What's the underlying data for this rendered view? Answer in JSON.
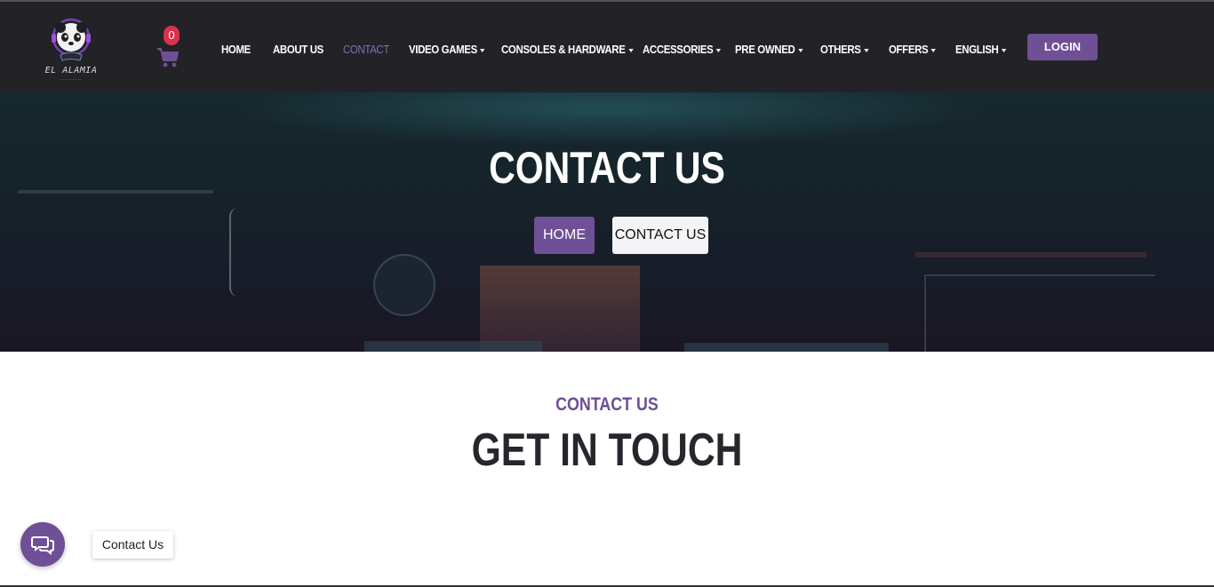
{
  "brand": {
    "name": "EL ALAMIA",
    "logo_icon": "panda-gamer-logo",
    "accent_color": "#6f4f96"
  },
  "cart": {
    "count": "0",
    "icon": "cart-icon"
  },
  "nav": {
    "items": [
      {
        "label": "HOME",
        "dropdown": false
      },
      {
        "label": "ABOUT US",
        "dropdown": false
      },
      {
        "label": "CONTACT",
        "dropdown": false,
        "active": true
      },
      {
        "label": "VIDEO GAMES",
        "dropdown": true
      },
      {
        "label": "CONSOLES & HARDWARE",
        "dropdown": true
      },
      {
        "label": "ACCESSORIES",
        "dropdown": true
      },
      {
        "label": "PRE OWNED",
        "dropdown": true
      },
      {
        "label": "OTHERS",
        "dropdown": true
      },
      {
        "label": "OFFERS",
        "dropdown": true
      },
      {
        "label": "ENGLISH",
        "dropdown": true
      }
    ],
    "login_label": "LOGIN"
  },
  "hero": {
    "title": "CONTACT US",
    "breadcrumb": {
      "home": "HOME",
      "current": "CONTACT US"
    }
  },
  "section": {
    "subtitle": "CONTACT US",
    "title": "GET IN TOUCH"
  },
  "chat_widget": {
    "label": "Contact Us",
    "icon": "chat-bubbles-icon"
  }
}
